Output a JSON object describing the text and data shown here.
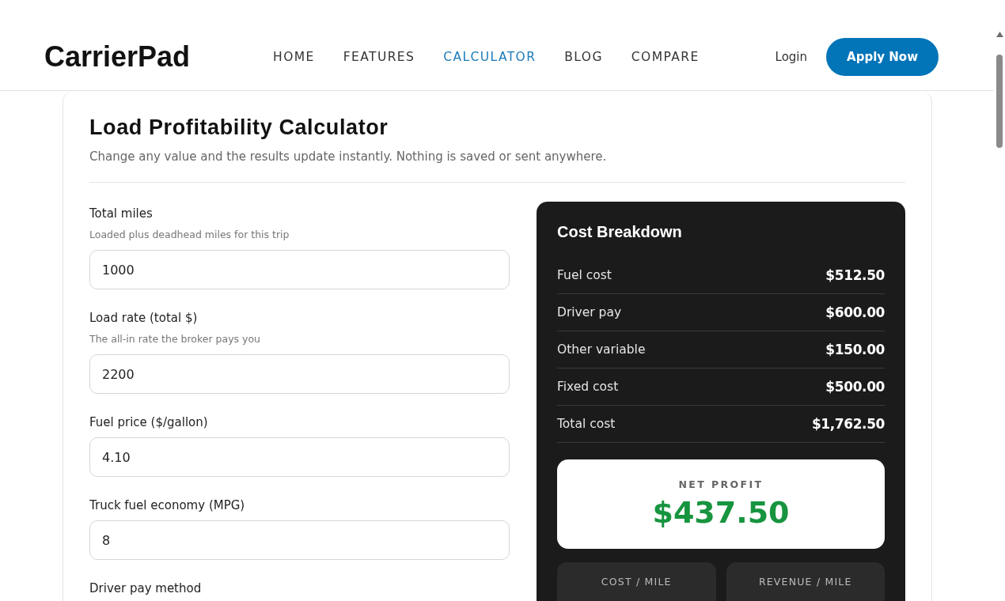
{
  "header": {
    "logo": "CarrierPad",
    "nav": [
      {
        "label": "HOME",
        "selected": false
      },
      {
        "label": "FEATURES",
        "selected": false
      },
      {
        "label": "CALCULATOR",
        "selected": true
      },
      {
        "label": "BLOG",
        "selected": false
      },
      {
        "label": "COMPARE",
        "selected": false
      }
    ],
    "login": "Login",
    "apply_button": "Apply Now"
  },
  "calculator": {
    "title": "Load Profitability Calculator",
    "subtitle": "Change any value and the results update instantly. Nothing is saved or sent anywhere.",
    "fields": [
      {
        "label": "Total miles",
        "hint": "Loaded plus deadhead miles for this trip",
        "value": "1000"
      },
      {
        "label": "Load rate (total $)",
        "hint": "The all-in rate the broker pays you",
        "value": "2200"
      },
      {
        "label": "Fuel price ($/gallon)",
        "value": "4.10"
      },
      {
        "label": "Truck fuel economy (MPG)",
        "value": "8"
      },
      {
        "label": "Driver pay method"
      }
    ],
    "breakdown": {
      "title": "Cost Breakdown",
      "rows": [
        {
          "label": "Fuel cost",
          "value": "$512.50"
        },
        {
          "label": "Driver pay",
          "value": "$600.00"
        },
        {
          "label": "Other variable",
          "value": "$150.00"
        },
        {
          "label": "Fixed cost",
          "value": "$500.00"
        },
        {
          "label": "Total cost",
          "value": "$1,762.50"
        }
      ],
      "net_profit": {
        "label": "NET PROFIT",
        "value": "$437.50"
      },
      "tiles": [
        {
          "label": "COST / MILE"
        },
        {
          "label": "REVENUE / MILE"
        }
      ]
    }
  }
}
